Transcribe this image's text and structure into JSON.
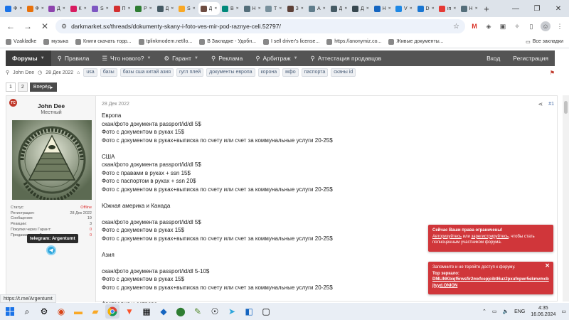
{
  "browser": {
    "tabs": [
      {
        "label": "Ф",
        "color": "#1a73e8"
      },
      {
        "label": "Ф",
        "color": "#e8710a"
      },
      {
        "label": "Д",
        "color": "#8e44ad"
      },
      {
        "label": "К",
        "color": "#d81b60"
      },
      {
        "label": "S",
        "color": "#7e57c2"
      },
      {
        "label": "П",
        "color": "#d32f2f"
      },
      {
        "label": "Р",
        "color": "#2e7d32"
      },
      {
        "label": "Д",
        "color": "#455a64"
      },
      {
        "label": "S",
        "color": "#f9a825"
      },
      {
        "label": "Д",
        "color": "#6d4c41",
        "active": true
      },
      {
        "label": "В",
        "color": "#00897b"
      },
      {
        "label": "Н",
        "color": "#546e7a"
      },
      {
        "label": "Т",
        "color": "#78909c"
      },
      {
        "label": "З",
        "color": "#5d4037"
      },
      {
        "label": "А",
        "color": "#607d8b"
      },
      {
        "label": "Д",
        "color": "#455a64"
      },
      {
        "label": "Д",
        "color": "#37474f"
      },
      {
        "label": "Н",
        "color": "#1565c0"
      },
      {
        "label": "V",
        "color": "#1e88e5"
      },
      {
        "label": "D",
        "color": "#1976d2"
      },
      {
        "label": "іп",
        "color": "#e53935"
      },
      {
        "label": "Н",
        "color": "#546e7a"
      }
    ],
    "new_tab_label": "+",
    "url": "darkmarket.sx/threads/dokumenty-skany-i-foto-ves-mir-pod-raznye-celi.52797/",
    "bookmarks": [
      "Vzakladke",
      "музыка",
      "Книги скачать торр...",
      "tplinkmodem.net/lo...",
      "В Закладке - Удобн...",
      "I sell driver's license...",
      "https://anonymiz.co...",
      "Живые документы..."
    ],
    "bookmarks_right": "Все закладки",
    "status_url": "https://t.me/Argentumt"
  },
  "forum": {
    "nav": [
      {
        "label": "Форумы",
        "active": true,
        "caret": true
      },
      {
        "label": "Правила",
        "icon": "⚲"
      },
      {
        "label": "Что нового?",
        "icon": "☰",
        "caret": true
      },
      {
        "label": "Гарант",
        "icon": "⚙",
        "caret": true
      },
      {
        "label": "Реклама",
        "icon": "⚲"
      },
      {
        "label": "Арбитраж",
        "icon": "⚲",
        "caret": true
      },
      {
        "label": "Аттестация продавцов",
        "icon": "⚲"
      }
    ],
    "nav_right": [
      "Вход",
      "Регистрация"
    ],
    "thread_meta": {
      "author": "John Dee",
      "date": "28 Дек 2022",
      "tags": [
        "usa",
        "базы",
        "базы сша китай азия",
        "гугл плей",
        "документы европа",
        "корона",
        "мфо",
        "паспорта",
        "сканы id"
      ]
    },
    "pager": {
      "pages": [
        "1",
        "2"
      ],
      "next": "Вперёд"
    }
  },
  "post": {
    "user": {
      "name": "John Dee",
      "title": "Местный",
      "badge": "TC",
      "stats": [
        {
          "label": "Статус:",
          "value": "Offline"
        },
        {
          "label": "Регистрация:",
          "value": "28 Дек 2022"
        },
        {
          "label": "Сообщения:",
          "value": "19"
        },
        {
          "label": "Реакции:",
          "value": "3"
        },
        {
          "label": "Покупки через Гарант:",
          "value": "0"
        },
        {
          "label": "Продажи через Гарант:",
          "value": "0"
        }
      ],
      "tooltip": "telegram: Argentumt"
    },
    "date": "28 Дек 2022",
    "number": "#1",
    "lines": [
      "Европа",
      "скан/фото документа passport/id/dl 5$",
      "Фото с документом в руках 15$",
      "Фото с документом в руках+выписка по счету или счет за коммунальные услуги 20-25$",
      "",
      "США",
      "скан/фото документа passport/id/dl 5$",
      "Фото с правами в руках + ssn 15$",
      "Фото с паспортом в руках + ssn 20$",
      "Фото с документом в руках+выписка по счету или счет за коммунальные услуги 20-25$",
      "",
      "Южная америка и Канада",
      "",
      "скан/фото документа passport/id/dl 5$",
      "Фото с документом в руках 15$",
      "Фото с документом в руках+выписка по счету или счет за коммунальные услуги 20-25$",
      "",
      "Азия",
      "",
      "скан/фото документа passport/id/dl 5-10$",
      "Фото с документом в руках 15$",
      "Фото с документом в руках+выписка по счету или счет за коммунальные услуги 20-25$",
      "",
      "Австралия и острова"
    ]
  },
  "notices": {
    "restricted": {
      "title": "Сейчас Ваши права ограничены!",
      "link1": "Авторизуйтесь",
      "middle": " или ",
      "link2": "зарегистрируйтесь",
      "tail": ", чтобы стать полноценным участником форума."
    },
    "mirror": {
      "text": "Запомните и не теряйте доступ к форуму.",
      "title": "Тор зеркало:",
      "onion": "DMLINKbiqf5rwsfir2mxfcepjcibtl6uz2pxufnpwr5ekmvmcbjtyyd.ONION"
    }
  },
  "taskbar": {
    "lang": "ENG",
    "time": "4:35",
    "date": "16.06.2024"
  }
}
